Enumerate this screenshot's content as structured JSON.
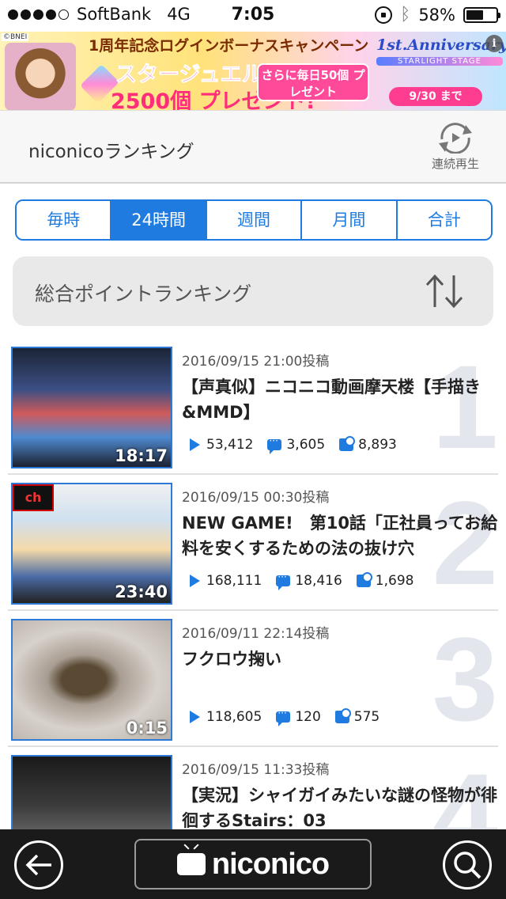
{
  "status_bar": {
    "carrier": "SoftBank",
    "network": "4G",
    "time": "7:05",
    "battery_percent": "58%",
    "battery_level": 0.58,
    "signal_dots_filled": 4,
    "signal_dots_total": 5
  },
  "banner": {
    "copyright": "©BNEI",
    "headline": "1周年記念ログインボーナスキャンペーン",
    "line1": "スタージュエル",
    "line2": "2500個 プレゼント!",
    "bonus": "さらに毎日50個 プレゼント",
    "anniversary": "1st.Anniversary",
    "anniversary_sub": "STARLIGHT STAGE",
    "date": "9/30 まで",
    "info_label": "i"
  },
  "header": {
    "title": "niconicoランキング",
    "replay_label": "連続再生"
  },
  "tabs": [
    {
      "label": "毎時",
      "active": false
    },
    {
      "label": "24時間",
      "active": true
    },
    {
      "label": "週間",
      "active": false
    },
    {
      "label": "月間",
      "active": false
    },
    {
      "label": "合計",
      "active": false
    }
  ],
  "category": {
    "label": "総合ポイントランキング"
  },
  "videos": [
    {
      "rank": "1",
      "date": "2016/09/15 21:00投稿",
      "title": "【声真似】ニコニコ動画摩天楼【手描き&MMD】",
      "duration": "18:17",
      "views": "53,412",
      "comments": "3,605",
      "mylists": "8,893",
      "channel_badge": ""
    },
    {
      "rank": "2",
      "date": "2016/09/15 00:30投稿",
      "title": "NEW GAME!　第10話「正社員ってお給料を安くするための法の抜け穴",
      "duration": "23:40",
      "views": "168,111",
      "comments": "18,416",
      "mylists": "1,698",
      "channel_badge": "ch"
    },
    {
      "rank": "3",
      "date": "2016/09/11 22:14投稿",
      "title": "フクロウ掬い",
      "duration": "0:15",
      "views": "118,605",
      "comments": "120",
      "mylists": "575",
      "channel_badge": ""
    },
    {
      "rank": "4",
      "date": "2016/09/15 11:33投稿",
      "title": "【実況】シャイガイみたいな謎の怪物が徘徊するStairs：03",
      "duration": "",
      "views": "",
      "comments": "",
      "mylists": "",
      "channel_badge": ""
    }
  ],
  "bottom_bar": {
    "logo": "niconico"
  },
  "colors": {
    "accent": "#1f7be0",
    "rank_number": "#e3e7ed",
    "bottom_bar": "#1a1a1a"
  }
}
